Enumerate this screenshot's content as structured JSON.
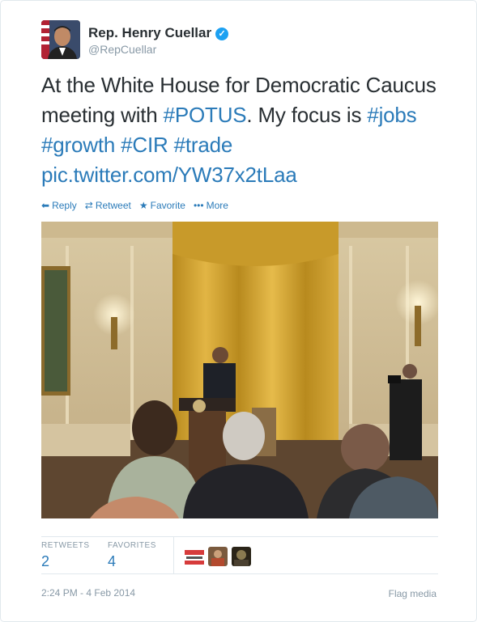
{
  "user": {
    "name": "Rep. Henry Cuellar",
    "handle": "@RepCuellar"
  },
  "tweet": {
    "segments": [
      {
        "text": "At the White House for Democratic Caucus meeting with ",
        "tag": false
      },
      {
        "text": "#POTUS",
        "tag": true
      },
      {
        "text": ". My focus is ",
        "tag": false
      },
      {
        "text": "#jobs",
        "tag": true
      },
      {
        "text": " ",
        "tag": false
      },
      {
        "text": "#growth",
        "tag": true
      },
      {
        "text": " ",
        "tag": false
      },
      {
        "text": "#CIR",
        "tag": true
      },
      {
        "text": " ",
        "tag": false
      },
      {
        "text": "#trade",
        "tag": true
      },
      {
        "text": " ",
        "tag": false
      },
      {
        "text": "pic.twitter.com/YW37x2tLaa",
        "tag": true
      }
    ]
  },
  "actions": {
    "reply": "Reply",
    "retweet": "Retweet",
    "favorite": "Favorite",
    "more": "More"
  },
  "stats": {
    "retweets_label": "RETWEETS",
    "retweets_value": "2",
    "favorites_label": "FAVORITES",
    "favorites_value": "4"
  },
  "footer": {
    "timestamp": "2:24 PM - 4 Feb 2014",
    "flag": "Flag media"
  },
  "colors": {
    "link": "#2b7bb9",
    "verified": "#1da1f2",
    "muted": "#8899a6"
  },
  "icons": [
    "verified-badge-icon",
    "reply-icon",
    "retweet-icon",
    "favorite-star-icon",
    "more-dots-icon"
  ]
}
